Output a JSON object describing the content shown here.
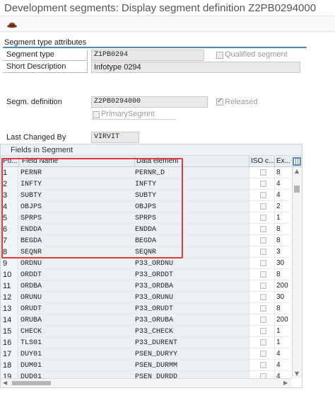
{
  "window": {
    "title": "Development segments: Display segment definition Z2PB0294000"
  },
  "toolbar": {
    "icons": [
      "other-object-icon"
    ]
  },
  "segment_type_attributes": {
    "group_title": "Segment type attributes",
    "segment_type_label": "Segment type",
    "segment_type_value": "Z1PB0294",
    "qualified_segment_label": "Qualified segment",
    "qualified_segment_checked": false,
    "short_description_label": "Short Description",
    "short_description_value": "Infotype 0294"
  },
  "segment_definition": {
    "label": "Segm. definition",
    "value": "Z2PB0294000",
    "released_label": "Released",
    "released_checked": true,
    "primary_segment_label": "PrimarySegmnt",
    "primary_segment_checked": false
  },
  "last_changed": {
    "label": "Last Changed By",
    "value": "VIRVIT"
  },
  "fields_table": {
    "caption": "Fields in Segment",
    "columns": {
      "pos": "Po...",
      "field_name": "Field Name",
      "data_element": "Data element",
      "iso": "ISO c...",
      "ext": "Ex..."
    },
    "rows": [
      {
        "pos": "1",
        "field": "PERNR",
        "de": "PERNR_D",
        "ext": "8"
      },
      {
        "pos": "2",
        "field": "INFTY",
        "de": "INFTY",
        "ext": "4"
      },
      {
        "pos": "3",
        "field": "SUBTY",
        "de": "SUBTY",
        "ext": "4"
      },
      {
        "pos": "4",
        "field": "OBJPS",
        "de": "OBJPS",
        "ext": "2"
      },
      {
        "pos": "5",
        "field": "SPRPS",
        "de": "SPRPS",
        "ext": "1"
      },
      {
        "pos": "6",
        "field": "ENDDA",
        "de": "ENDDA",
        "ext": "8"
      },
      {
        "pos": "7",
        "field": "BEGDA",
        "de": "BEGDA",
        "ext": "8"
      },
      {
        "pos": "8",
        "field": "SEQNR",
        "de": "SEQNR",
        "ext": "3"
      },
      {
        "pos": "9",
        "field": "ORDNU",
        "de": "P33_ORDNU",
        "ext": "30"
      },
      {
        "pos": "10",
        "field": "ORDDT",
        "de": "P33_ORDDT",
        "ext": "8"
      },
      {
        "pos": "11",
        "field": "ORDBA",
        "de": "P33_ORDBA",
        "ext": "200"
      },
      {
        "pos": "12",
        "field": "ORUNU",
        "de": "P33_ORUNU",
        "ext": "30"
      },
      {
        "pos": "13",
        "field": "ORUDT",
        "de": "P33_ORUDT",
        "ext": "8"
      },
      {
        "pos": "14",
        "field": "ORUBA",
        "de": "P33_ORUBA",
        "ext": "200"
      },
      {
        "pos": "15",
        "field": "CHECK",
        "de": "P33_CHECK",
        "ext": "1"
      },
      {
        "pos": "16",
        "field": "TLS01",
        "de": "P33_DURENT",
        "ext": "1"
      },
      {
        "pos": "17",
        "field": "DUY01",
        "de": "PSEN_DURYY",
        "ext": "4"
      },
      {
        "pos": "18",
        "field": "DUM01",
        "de": "PSEN_DURMM",
        "ext": "4"
      },
      {
        "pos": "19",
        "field": "DUD01",
        "de": "PSEN_DURDD",
        "ext": "4"
      }
    ]
  },
  "colors": {
    "accent": "#4a8eb4",
    "highlight": "#e0393e"
  }
}
